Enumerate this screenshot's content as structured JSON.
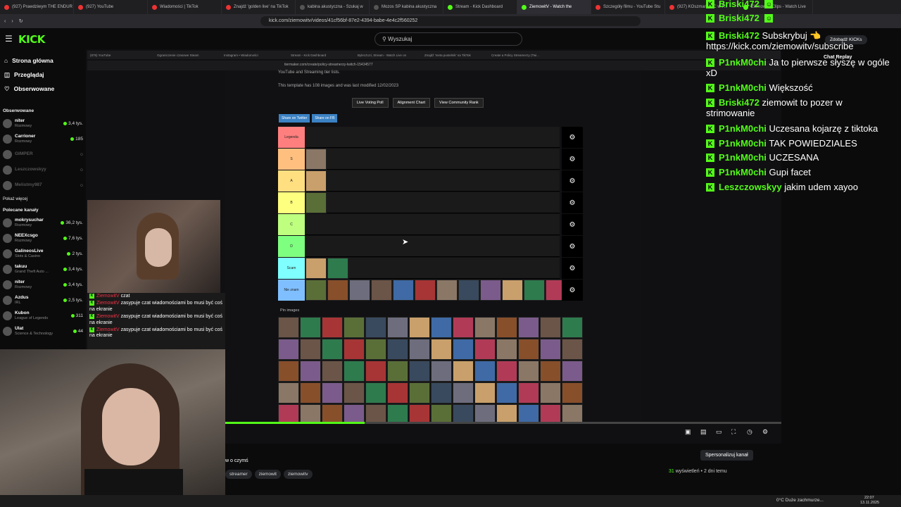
{
  "browser": {
    "tabs": [
      {
        "label": "(927) Prawdziwym THE ENDUR",
        "icon": "youtube-icon"
      },
      {
        "label": "(927) YouTube",
        "icon": "youtube-icon"
      },
      {
        "label": "Wiadomości | TikTok",
        "icon": "tiktok-icon"
      },
      {
        "label": "Znajdź 'golden live' na TikTok",
        "icon": "tiktok-icon"
      },
      {
        "label": "kabina akustyczna - Szukaj w",
        "icon": "google-icon"
      },
      {
        "label": "Mozos SP kabina akustyczna",
        "icon": "shop-icon"
      },
      {
        "label": "Stream - Kick Dashboard",
        "icon": "kick-icon"
      },
      {
        "label": "ZiemowitV - Watch the",
        "icon": "kick-icon"
      },
      {
        "label": "Szczegóły filmu - YouTube Stu",
        "icon": "youtube-icon"
      },
      {
        "label": "(927) KOszmar NOC w P...",
        "icon": "youtube-icon"
      },
      {
        "label": "ZiemowitV Clips - Watch Live",
        "icon": "kick-icon"
      }
    ],
    "active_tab": 7,
    "url": "kick.com/ziemowitv/videos/41cf56bf-87e2-4394-babe-4e4c2f560252"
  },
  "header": {
    "logo": "KICK",
    "search_placeholder": "Wyszukaj",
    "kicks_button": "Zdobądź KICKs"
  },
  "sidebar": {
    "nav": [
      {
        "label": "Strona główna",
        "icon": "home-icon"
      },
      {
        "label": "Przeglądaj",
        "icon": "browse-icon"
      },
      {
        "label": "Obserwowane",
        "icon": "heart-icon"
      }
    ],
    "followed_title": "Obserwowane",
    "followed": [
      {
        "name": "niter",
        "category": "Rozmowy",
        "count": "3,4 tys.",
        "live": true
      },
      {
        "name": "Carrioner",
        "category": "Rozmowy",
        "count": "185",
        "live": true
      },
      {
        "name": "GIMPER",
        "category": "",
        "count": "",
        "live": false
      },
      {
        "name": "Leszczowskyy",
        "category": "",
        "count": "",
        "live": false
      },
      {
        "name": "Melistmy987",
        "category": "",
        "count": "",
        "live": false
      }
    ],
    "show_more": "Pokaż więcej",
    "recommended_title": "Polecane kanały",
    "recommended": [
      {
        "name": "mokrysuchar",
        "category": "Rozmowy",
        "count": "36,2 tys."
      },
      {
        "name": "NEEXcsgo",
        "category": "Rozmowy",
        "count": "7,6 tys."
      },
      {
        "name": "GalineosLive",
        "category": "Slots & Casino",
        "count": "2 tys."
      },
      {
        "name": "takuu",
        "category": "Grand Theft Auto ...",
        "count": "3,4 tys."
      },
      {
        "name": "niter",
        "category": "Rozmowy",
        "count": "3,4 tys."
      },
      {
        "name": "Azdus",
        "category": "IRL",
        "count": "2,5 tys."
      },
      {
        "name": "Kubon",
        "category": "League of Legends",
        "count": "311"
      },
      {
        "name": "Ulat",
        "category": "Science & Technology",
        "count": "44"
      }
    ]
  },
  "video": {
    "inner_tabs": [
      "(875) YouTube",
      "Ograniczenie czasowe Steam",
      "Instagram • Wiadomości",
      "Stream - Kick Dashboard",
      "ByleczUzi, Stream - Watch Live on",
      "Znajdź 'meta pustelnik' na TikTok",
      "Create a Policy Streamerzy (Twi..."
    ],
    "inner_url": "tiermaker.com/create/policy-streamerzy-twitch-15434577",
    "tier_text_1": "YouTube and Streaming tier lists.",
    "tier_text_2": "This template has 108 images and was last modified 12/02/2023",
    "buttons": [
      "Live Voting Poll",
      "Alignment Chart",
      "View Community Rank"
    ],
    "share": [
      "Share on Twitter",
      "Share on FB"
    ],
    "tiers": [
      {
        "label": "Legenda",
        "color": "#ff7f7f"
      },
      {
        "label": "S",
        "color": "#ffbf7f"
      },
      {
        "label": "A",
        "color": "#ffdf7f"
      },
      {
        "label": "B",
        "color": "#ffff7f"
      },
      {
        "label": "C",
        "color": "#bfff7f"
      },
      {
        "label": "D",
        "color": "#7fff7f"
      },
      {
        "label": "Scam",
        "color": "#7fffff"
      },
      {
        "label": "Nie znam",
        "color": "#7fbfff"
      }
    ],
    "pin_label": "Pin images",
    "progress_fraction": 0.25,
    "cam_chat": [
      {
        "user": "ZiemowitV",
        "text": "czat"
      },
      {
        "user": "ZiemowitV",
        "text": "zasypuje czat wiadomościami bo musi być coś na ekranie"
      },
      {
        "user": "ZiemowitV",
        "text": "zasypuje czat wiadomościami bo musi być coś na ekranie"
      },
      {
        "user": "ZiemowitV",
        "text": "zasypuje czat wiadomościami bo musi być coś na ekranie"
      }
    ]
  },
  "chat": {
    "title": "Chat Replay",
    "messages": [
      {
        "user": "Briski472",
        "text": ""
      },
      {
        "user": "Briski472",
        "text": ""
      },
      {
        "user": "Briski472",
        "text": "Subskrybuj 👈 https://kick.com/ziemowitv/subscribe"
      },
      {
        "user": "P1nkM0chi",
        "text": "Ja to pierwsze słyszę w ogóle xD"
      },
      {
        "user": "P1nkM0chi",
        "text": "Większość"
      },
      {
        "user": "Briski472",
        "text": "ziemowit to pozer w strimowanie"
      },
      {
        "user": "P1nkM0chi",
        "text": "Uczesana kojarzę z tiktoka"
      },
      {
        "user": "P1nkM0chi",
        "text": "TAK POWIEDZIALES"
      },
      {
        "user": "P1nkM0chi",
        "text": "UCZESANA"
      },
      {
        "user": "P1nkM0chi",
        "text": "Gupi facet"
      },
      {
        "user": "Leszczowskyy",
        "text": "jakim udem xayoo"
      }
    ]
  },
  "below": {
    "title": "w o czymś",
    "tags": [
      "streamer",
      "ziemowit",
      "ziemowitv"
    ],
    "views": "31",
    "views_label": "wyświetleń",
    "age": "2 dni temu",
    "personalize": "Spersonalizuj kanał"
  },
  "taskbar": {
    "weather": "0°C  Duże zachmurze...",
    "time": "22:07",
    "date": "13.11.2025"
  }
}
